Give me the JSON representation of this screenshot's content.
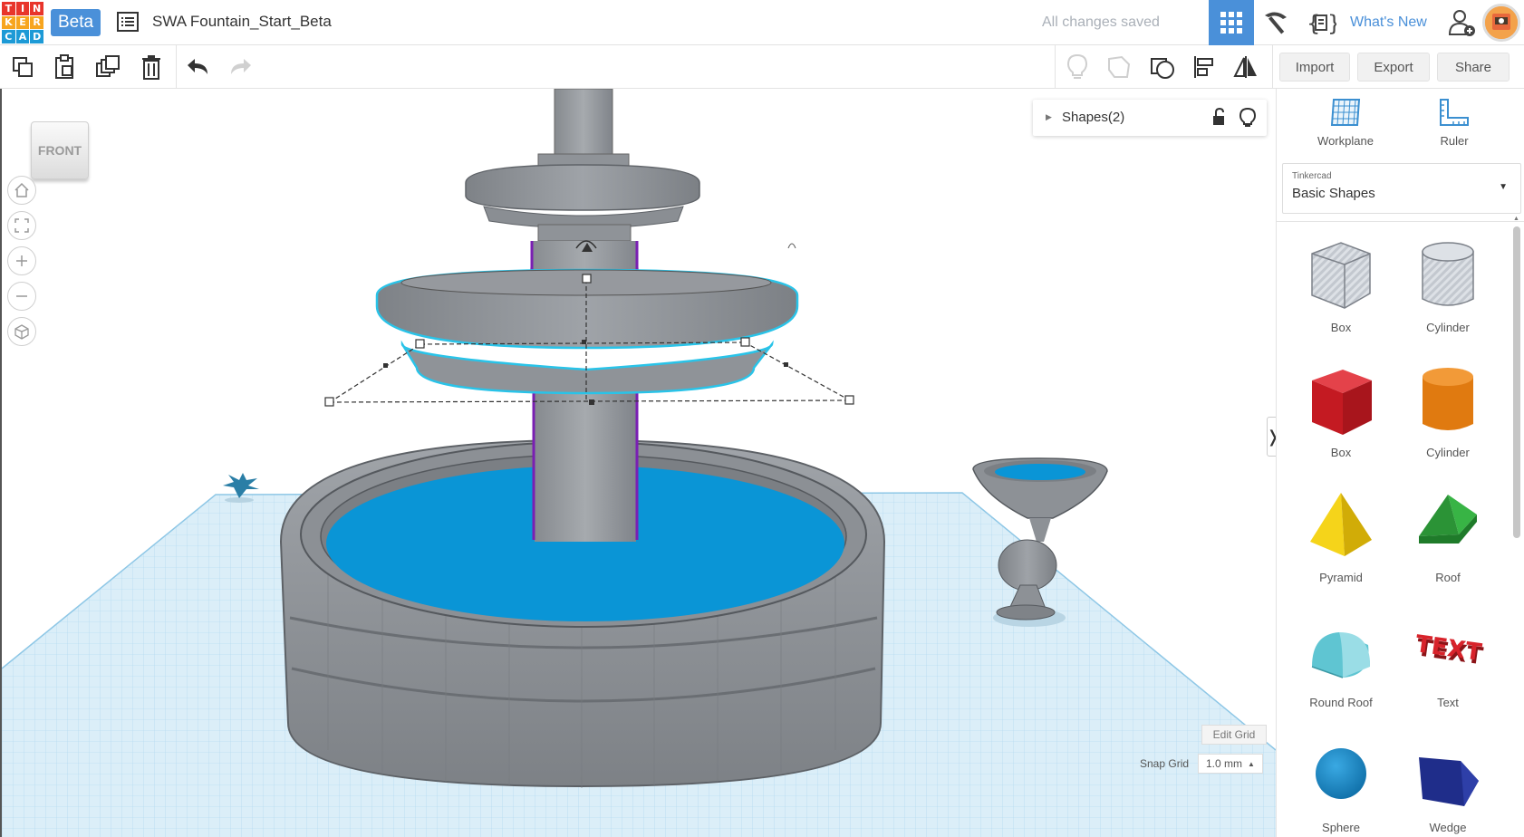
{
  "header": {
    "logo_letters": [
      "T",
      "I",
      "N",
      "K",
      "E",
      "R",
      "C",
      "A",
      "D"
    ],
    "logo_colors": [
      "#e8352b",
      "#e8352b",
      "#e8352b",
      "#f7a51e",
      "#f7a51e",
      "#f7a51e",
      "#1d9ad6",
      "#1d9ad6",
      "#1d9ad6"
    ],
    "beta_label": "Beta",
    "design_title": "SWA Fountain_Start_Beta",
    "save_status": "All changes saved",
    "whats_new": "What's New",
    "icons": [
      "design-list-icon",
      "grid-view-icon",
      "pickaxe-icon",
      "code-blocks-icon",
      "add-user-icon",
      "avatar"
    ]
  },
  "toolbar": {
    "left_icons": [
      "copy-icon",
      "paste-icon",
      "duplicate-icon",
      "delete-icon",
      "undo-icon",
      "redo-icon"
    ],
    "right_icons": [
      "bulb-icon",
      "hole-icon",
      "group-icon",
      "align-icon",
      "mirror-icon"
    ],
    "import_label": "Import",
    "export_label": "Export",
    "share_label": "Share"
  },
  "viewport": {
    "view_cube_label": "FRONT",
    "nav_icons": [
      "home-view-icon",
      "fit-view-icon",
      "zoom-in-icon",
      "zoom-out-icon",
      "perspective-icon"
    ],
    "shapes_panel_label": "Shapes(2)",
    "edit_grid_label": "Edit Grid",
    "snap_grid_label": "Snap Grid",
    "snap_grid_value": "1.0 mm",
    "panel_toggle": "❭",
    "colors": {
      "water": "#0a95d6",
      "stone": "#8d9196",
      "workplane": "#dbeef8",
      "selection": "#29c3e8",
      "selection_purple": "#7a1fb3"
    }
  },
  "right_panel": {
    "workplane_label": "Workplane",
    "ruler_label": "Ruler",
    "library_caption": "Tinkercad",
    "library_value": "Basic Shapes",
    "shapes": [
      {
        "label": "Box",
        "color": "#b9bec6"
      },
      {
        "label": "Cylinder",
        "color": "#b9bec6"
      },
      {
        "label": "Box",
        "color": "#d8202a"
      },
      {
        "label": "Cylinder",
        "color": "#e8780d"
      },
      {
        "label": "Pyramid",
        "color": "#f2d10a"
      },
      {
        "label": "Roof",
        "color": "#2fa33a"
      },
      {
        "label": "Round Roof",
        "color": "#59c3cf"
      },
      {
        "label": "Text",
        "color": "#cc1f26"
      },
      {
        "label": "Sphere",
        "color": "#1886c9"
      },
      {
        "label": "Wedge",
        "color": "#1f2d8a"
      }
    ]
  }
}
